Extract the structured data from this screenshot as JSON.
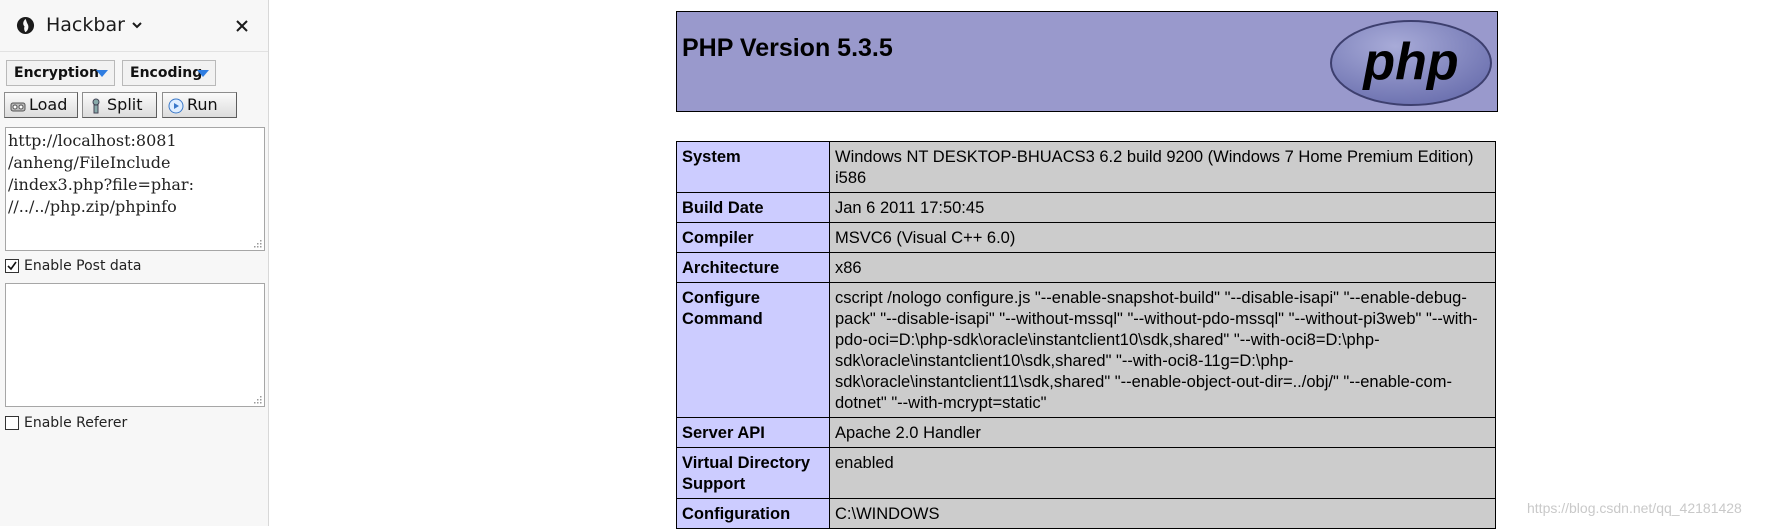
{
  "sidebar": {
    "title": "Hackbar",
    "icons": {
      "logo": "firefox-extension-icon",
      "chevron": "chevron-down-icon",
      "close": "close-icon"
    },
    "dropdowns": {
      "encryption": "Encryption",
      "encoding": "Encoding"
    },
    "buttons": {
      "load": "Load",
      "split": "Split",
      "run": "Run"
    },
    "url_text": "http://localhost:8081\n/anheng/FileInclude\n/index3.php?file=phar:\n//../../php.zip/phpinfo",
    "post_data": "",
    "enable_post": {
      "label": "Enable Post data",
      "checked": true
    },
    "enable_referer": {
      "label": "Enable Referer",
      "checked": false
    }
  },
  "phpinfo": {
    "version_title": "PHP Version 5.3.5",
    "logo_text": "php",
    "rows": [
      {
        "key": "System",
        "value": "Windows NT DESKTOP-BHUACS3 6.2 build 9200 (Windows 7 Home Premium Edition) i586"
      },
      {
        "key": "Build Date",
        "value": "Jan 6 2011 17:50:45"
      },
      {
        "key": "Compiler",
        "value": "MSVC6 (Visual C++ 6.0)"
      },
      {
        "key": "Architecture",
        "value": "x86"
      },
      {
        "key": "Configure Command",
        "value": "cscript /nologo configure.js \"--enable-snapshot-build\" \"--disable-isapi\" \"--enable-debug-pack\" \"--disable-isapi\" \"--without-mssql\" \"--without-pdo-mssql\" \"--without-pi3web\" \"--with-pdo-oci=D:\\php-sdk\\oracle\\instantclient10\\sdk,shared\" \"--with-oci8=D:\\php-sdk\\oracle\\instantclient10\\sdk,shared\" \"--with-oci8-11g=D:\\php-sdk\\oracle\\instantclient11\\sdk,shared\" \"--enable-object-out-dir=../obj/\" \"--enable-com-dotnet\" \"--with-mcrypt=static\""
      },
      {
        "key": "Server API",
        "value": "Apache 2.0 Handler"
      },
      {
        "key": "Virtual Directory Support",
        "value": "enabled"
      },
      {
        "key": "Configuration",
        "value": "C:\\WINDOWS"
      }
    ]
  },
  "watermark": "https://blog.csdn.net/qq_42181428"
}
